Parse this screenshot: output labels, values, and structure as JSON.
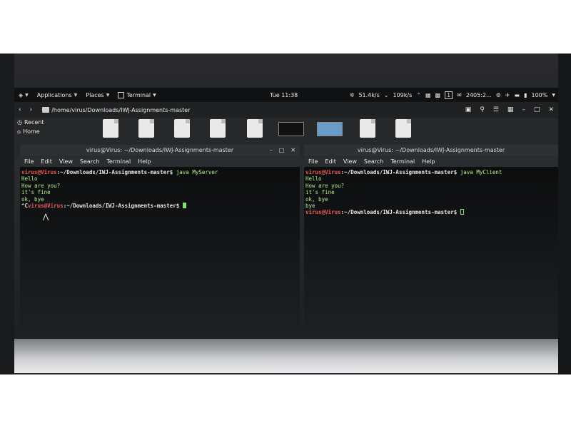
{
  "topbar": {
    "activities_icon": "kali-dragon-icon",
    "applications_label": "Applications",
    "places_label": "Places",
    "terminal_label": "Terminal",
    "clock": "Tue 11:38",
    "net_down": "51.4",
    "net_down_unit": "k/s",
    "net_up": "109",
    "net_up_unit": "k/s",
    "workspace_number": "1",
    "mail_count": "2405:2...",
    "battery": "100%"
  },
  "file_manager": {
    "path": "/home/virus/Downloads/IWJ-Assignments-master",
    "sidebar": [
      {
        "label": "Recent",
        "icon": "clock-icon"
      },
      {
        "label": "Home",
        "icon": "home-icon"
      }
    ]
  },
  "left_terminal": {
    "title": "virus@Virus: ~/Downloads/IWJ-Assignments-master",
    "menu": [
      "File",
      "Edit",
      "View",
      "Search",
      "Terminal",
      "Help"
    ],
    "prompt_user": "virus@Virus",
    "prompt_path": ":~/Downloads/IWJ-Assignments-master$",
    "command": " java MyServer",
    "output": [
      "Hello",
      "How are you?",
      "it's fine",
      "ok, bye"
    ],
    "interrupt_prefix": "^C",
    "second_prompt_user": "virus@Virus",
    "second_prompt_path": ":~/Downloads/IWJ-Assignments-master$"
  },
  "right_terminal": {
    "title": "virus@Virus: ~/Downloads/IWJ-Assignments-master",
    "menu": [
      "File",
      "Edit",
      "View",
      "Search",
      "Terminal",
      "Help"
    ],
    "prompt_user": "virus@Virus",
    "prompt_path": ":~/Downloads/IWJ-Assignments-master$",
    "command": " java MyClient",
    "output": [
      "Hello",
      "How are you?",
      "it's fine",
      "ok, bye",
      "bye"
    ],
    "second_prompt_user": "virus@Virus",
    "second_prompt_path": ":~/Downloads/IWJ-Assignments-master$"
  },
  "colors": {
    "prompt_user": "#f05a5a",
    "prompt_text": "#b6f08e",
    "topbar_bg": "#101113"
  }
}
